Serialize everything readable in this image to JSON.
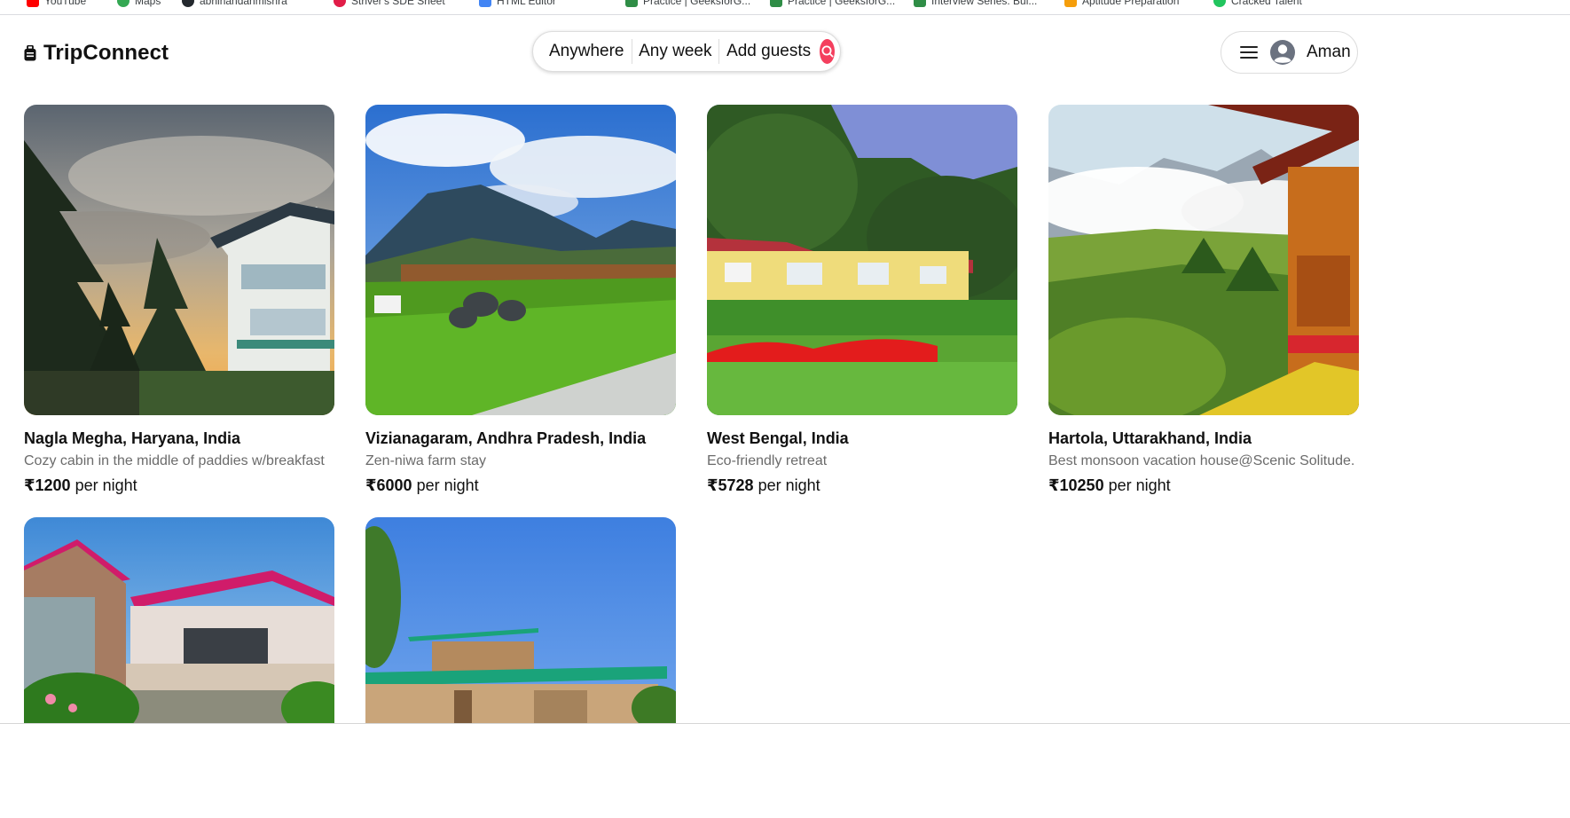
{
  "bookmarks": [
    {
      "label": "YouTube",
      "color": "#ff0000"
    },
    {
      "label": "Maps",
      "color": "#34a853"
    },
    {
      "label": "abhinandanmishra"
    },
    {
      "label": "Striver's SDE Sheet"
    },
    {
      "label": "HTML Editor"
    },
    {
      "label": "Practice | GeeksforG..."
    },
    {
      "label": "Practice | GeeksforG..."
    },
    {
      "label": "Interview Series: Bui..."
    },
    {
      "label": "Aptitude Preparation"
    },
    {
      "label": "Cracked Talent"
    }
  ],
  "header": {
    "brand": "TripConnect",
    "search": {
      "location": "Anywhere",
      "week": "Any week",
      "guests": "Add guests"
    },
    "user": {
      "name": "Aman"
    }
  },
  "listings": [
    {
      "title": "Nagla Megha, Haryana, India",
      "description": "Cozy cabin in the middle of paddies w/breakfast",
      "price": "₹1200",
      "price_unit": "per night"
    },
    {
      "title": "Vizianagaram, Andhra Pradesh, India",
      "description": "Zen-niwa farm stay",
      "price": "₹6000",
      "price_unit": "per night"
    },
    {
      "title": "West Bengal, India",
      "description": "Eco-friendly retreat",
      "price": "₹5728",
      "price_unit": "per night"
    },
    {
      "title": "Hartola, Uttarakhand, India",
      "description": "Best monsoon vacation house@Scenic Solitude.",
      "price": "₹10250",
      "price_unit": "per night"
    }
  ],
  "colors": {
    "accent": "#f43f5e",
    "muted_text": "#6b6b6b",
    "border": "#dddddd"
  }
}
